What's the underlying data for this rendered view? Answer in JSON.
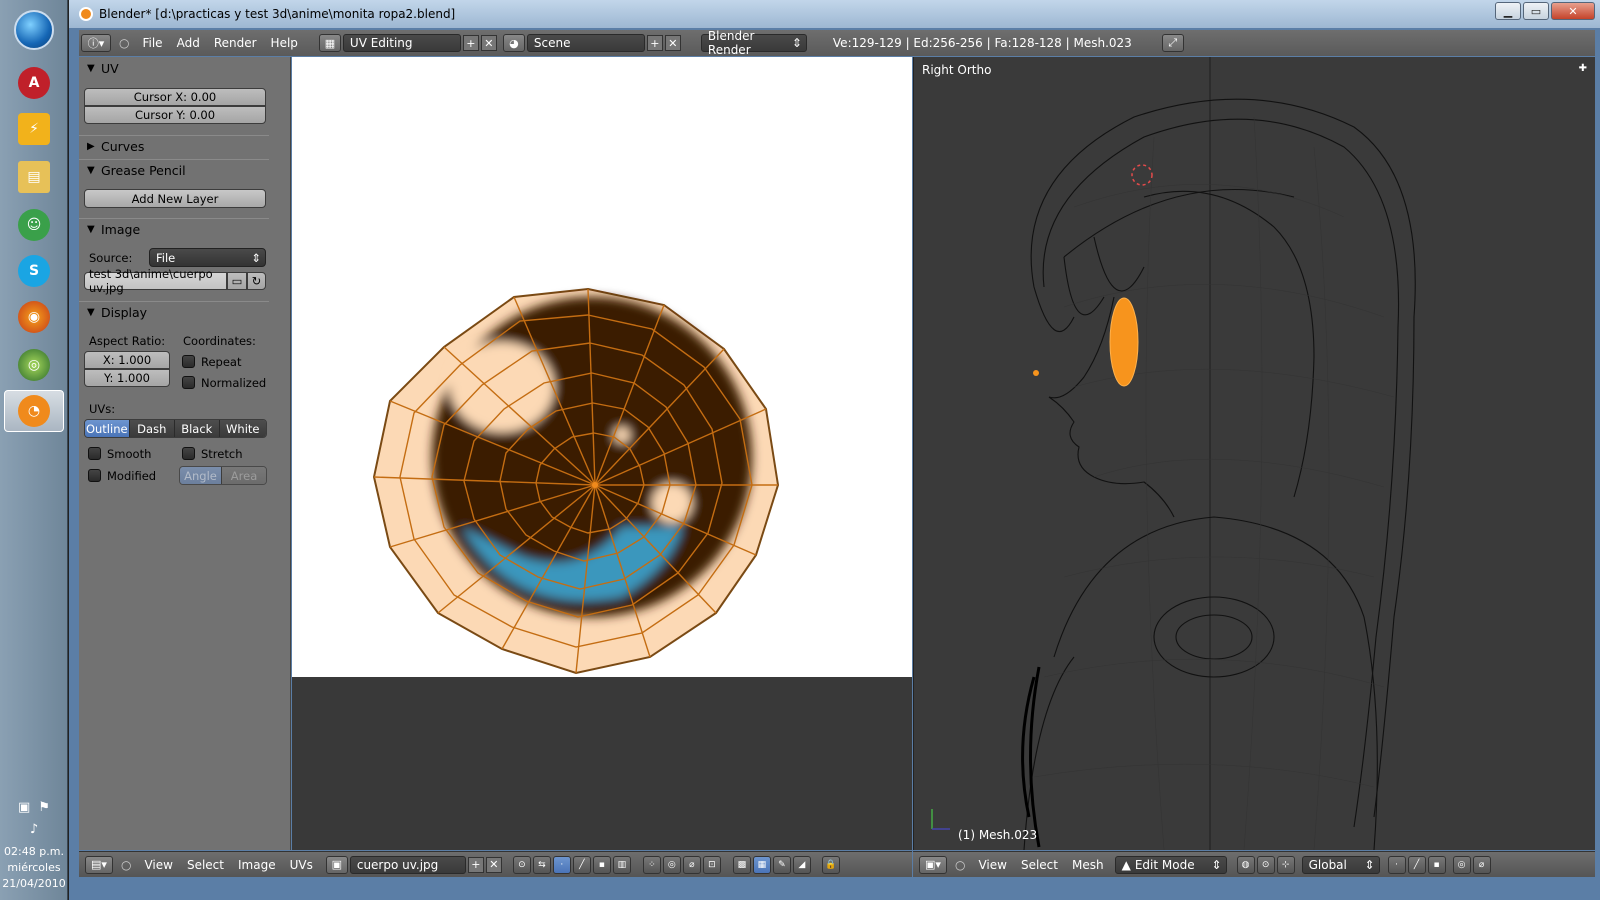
{
  "window": {
    "title": "Blender* [d:\\practicas y test 3d\\anime\\monita ropa2.blend]",
    "controls": [
      "minimize",
      "maximize",
      "close"
    ]
  },
  "taskbar": {
    "apps": [
      "ALC",
      "Winamp",
      "File Explorer",
      "Messenger",
      "Skype",
      "Firefox",
      "Google Earth",
      "Blender"
    ],
    "time": "02:48 p.m.",
    "day": "miércoles",
    "date": "21/04/2010"
  },
  "info_header": {
    "menus": [
      "File",
      "Add",
      "Render",
      "Help"
    ],
    "layout": "UV Editing",
    "scene": "Scene",
    "engine": "Blender Render",
    "stats": "Ve:129-129 | Ed:256-256 | Fa:128-128 | Mesh.023"
  },
  "props": {
    "uv_header": "UV",
    "cursor_x": "Cursor X: 0.00",
    "cursor_y": "Cursor Y: 0.00",
    "curves_header": "Curves",
    "grease_header": "Grease Pencil",
    "add_layer": "Add New Layer",
    "image_header": "Image",
    "source_label": "Source:",
    "source_value": "File",
    "filepath": "test 3d\\anime\\cuerpo uv.jpg",
    "display_header": "Display",
    "aspect_label": "Aspect Ratio:",
    "coords_label": "Coordinates:",
    "aspect_x": "X: 1.000",
    "aspect_y": "Y: 1.000",
    "repeat": "Repeat",
    "normalized": "Normalized",
    "uvs_label": "UVs:",
    "uv_modes": [
      "Outline",
      "Dash",
      "Black",
      "White"
    ],
    "uv_mode_selected": "Outline",
    "smooth": "Smooth",
    "stretch": "Stretch",
    "modified": "Modified",
    "stretch_modes": [
      "Angle",
      "Area"
    ]
  },
  "image_editor": {
    "menus": [
      "View",
      "Select",
      "Image",
      "UVs"
    ],
    "image_name": "cuerpo uv.jpg"
  },
  "viewport": {
    "title": "Right Ortho",
    "object_label": "(1) Mesh.023",
    "menus": [
      "View",
      "Select",
      "Mesh"
    ],
    "mode": "Edit Mode",
    "orientation": "Global"
  },
  "colors": {
    "accent": "#f08a1c",
    "selection_blue": "#5680c2",
    "panel_bg": "#727272",
    "viewport_bg": "#3a3a3a"
  }
}
